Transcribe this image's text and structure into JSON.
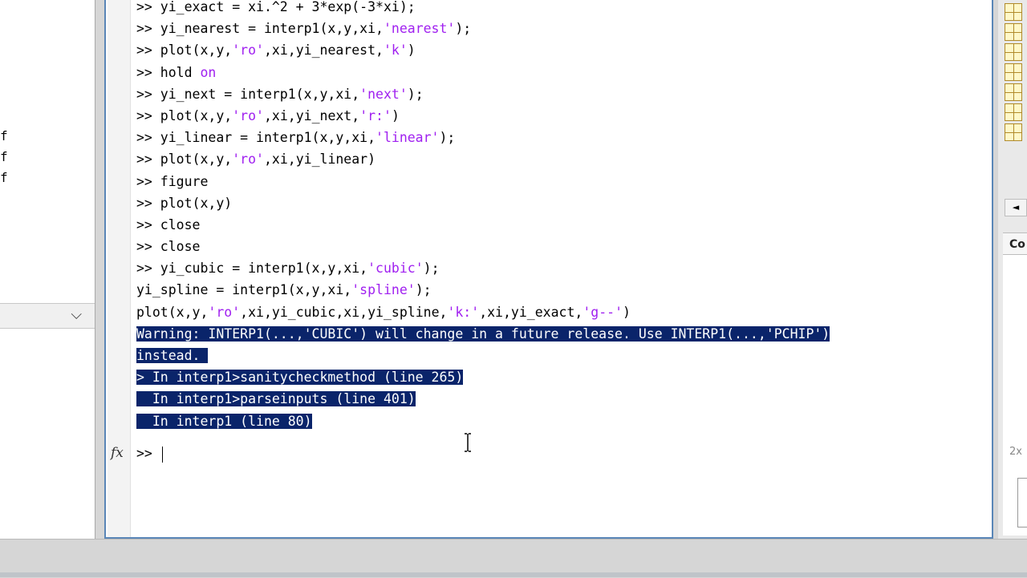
{
  "left_panel": {
    "fragments": [
      "f",
      "f",
      "f"
    ],
    "collapse_icon": "chevron-down-icon"
  },
  "command_window": {
    "lines": [
      {
        "segments": [
          {
            "t": ">> yi_exact = xi.^2 + 3*exp(-3*xi);"
          }
        ]
      },
      {
        "segments": [
          {
            "t": ">> yi_nearest = interp1(x,y,xi,"
          },
          {
            "t": "'nearest'",
            "s": true
          },
          {
            "t": ");"
          }
        ]
      },
      {
        "segments": [
          {
            "t": ">> plot(x,y,"
          },
          {
            "t": "'ro'",
            "s": true
          },
          {
            "t": ",xi,yi_nearest,"
          },
          {
            "t": "'k'",
            "s": true
          },
          {
            "t": ")"
          }
        ]
      },
      {
        "segments": [
          {
            "t": ">> hold "
          },
          {
            "t": "on",
            "s": true
          }
        ]
      },
      {
        "segments": [
          {
            "t": ">> yi_next = interp1(x,y,xi,"
          },
          {
            "t": "'next'",
            "s": true
          },
          {
            "t": ");"
          }
        ]
      },
      {
        "segments": [
          {
            "t": ">> plot(x,y,"
          },
          {
            "t": "'ro'",
            "s": true
          },
          {
            "t": ",xi,yi_next,"
          },
          {
            "t": "'r:'",
            "s": true
          },
          {
            "t": ")"
          }
        ]
      },
      {
        "segments": [
          {
            "t": ">> yi_linear = interp1(x,y,xi,"
          },
          {
            "t": "'linear'",
            "s": true
          },
          {
            "t": ");"
          }
        ]
      },
      {
        "segments": [
          {
            "t": ">> plot(x,y,"
          },
          {
            "t": "'ro'",
            "s": true
          },
          {
            "t": ",xi,yi_linear)"
          }
        ]
      },
      {
        "segments": [
          {
            "t": ">> figure"
          }
        ]
      },
      {
        "segments": [
          {
            "t": ">> plot(x,y)"
          }
        ]
      },
      {
        "segments": [
          {
            "t": ">> close"
          }
        ]
      },
      {
        "segments": [
          {
            "t": ">> close"
          }
        ]
      },
      {
        "segments": [
          {
            "t": ">> yi_cubic = interp1(x,y,xi,"
          },
          {
            "t": "'cubic'",
            "s": true
          },
          {
            "t": ");"
          }
        ]
      },
      {
        "segments": [
          {
            "t": "yi_spline = interp1(x,y,xi,"
          },
          {
            "t": "'spline'",
            "s": true
          },
          {
            "t": ");"
          }
        ]
      },
      {
        "segments": [
          {
            "t": "plot(x,y,"
          },
          {
            "t": "'ro'",
            "s": true
          },
          {
            "t": ",xi,yi_cubic,xi,yi_spline,"
          },
          {
            "t": "'k:'",
            "s": true
          },
          {
            "t": ",xi,yi_exact,"
          },
          {
            "t": "'g--'",
            "s": true
          },
          {
            "t": ")"
          }
        ]
      },
      {
        "sel": true,
        "segments": [
          {
            "t": "Warning: INTERP1(...,'CUBIC') will change in a future release. Use INTERP1(...,'PCHIP')"
          }
        ]
      },
      {
        "sel": true,
        "segments": [
          {
            "t": "instead. "
          }
        ]
      },
      {
        "sel": true,
        "segments": [
          {
            "t": "> In interp1>sanitycheckmethod (line 265)"
          }
        ]
      },
      {
        "sel": true,
        "segments": [
          {
            "t": "  In interp1>parseinputs (line 401)"
          }
        ]
      },
      {
        "sel": true,
        "segments": [
          {
            "t": "  In interp1 (line 80)"
          }
        ]
      }
    ],
    "prompt": ">> ",
    "fx_label": "fx",
    "colors": {
      "string": "#a020f0",
      "selection_bg": "#0a246a",
      "selection_fg": "#ffffff",
      "frame": "#5a86b7"
    }
  },
  "right_panel": {
    "title_fragment": "Co",
    "zoom_label": "2x",
    "scroll_glyph": "◄"
  }
}
